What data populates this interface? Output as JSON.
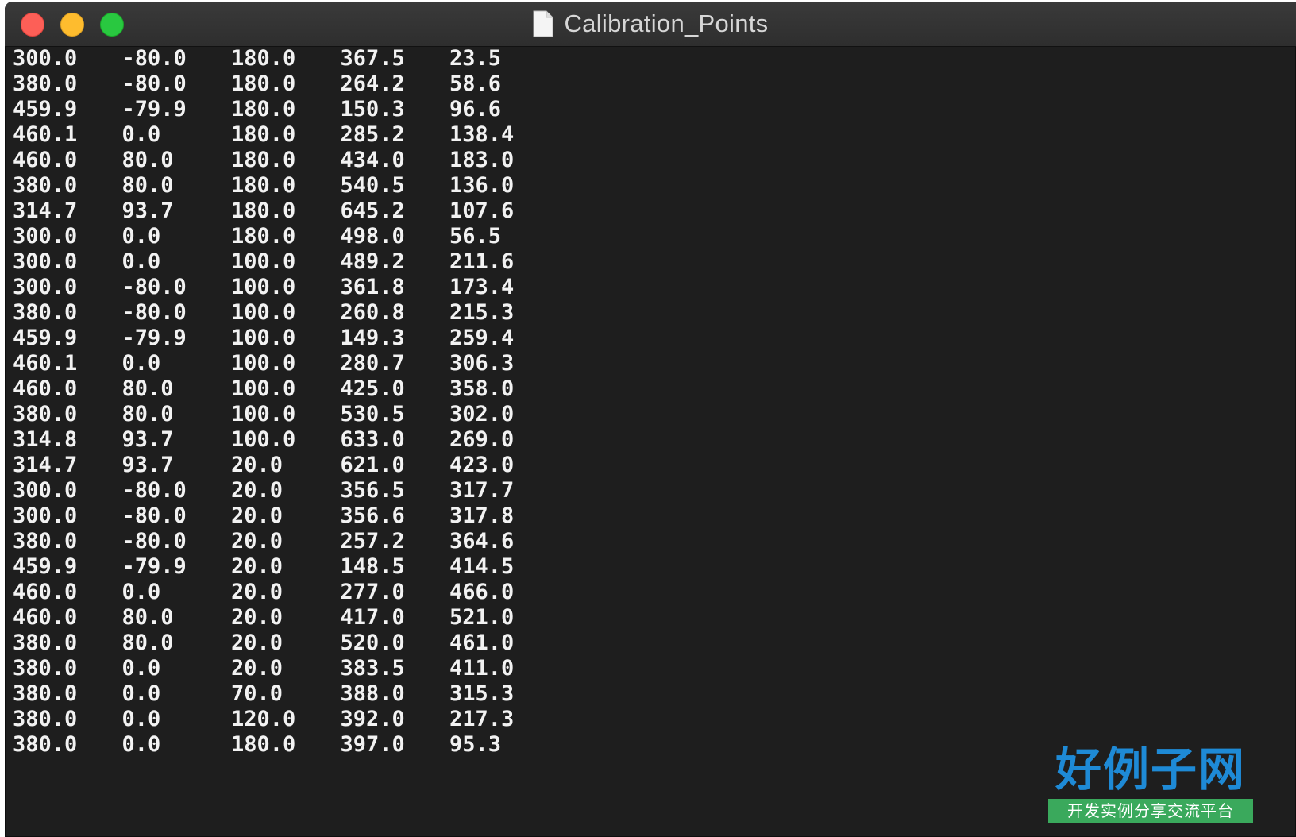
{
  "window": {
    "title": "Calibration_Points"
  },
  "rows": [
    [
      "300.0",
      "-80.0",
      "180.0",
      "367.5",
      "23.5"
    ],
    [
      "380.0",
      "-80.0",
      "180.0",
      "264.2",
      "58.6"
    ],
    [
      "459.9",
      "-79.9",
      "180.0",
      "150.3",
      "96.6"
    ],
    [
      "460.1",
      "0.0",
      "180.0",
      "285.2",
      "138.4"
    ],
    [
      "460.0",
      "80.0",
      "180.0",
      "434.0",
      "183.0"
    ],
    [
      "380.0",
      "80.0",
      "180.0",
      "540.5",
      "136.0"
    ],
    [
      "314.7",
      "93.7",
      "180.0",
      "645.2",
      "107.6"
    ],
    [
      "300.0",
      "0.0",
      "180.0",
      "498.0",
      "56.5"
    ],
    [
      "300.0",
      "0.0",
      "100.0",
      "489.2",
      "211.6"
    ],
    [
      "300.0",
      "-80.0",
      "100.0",
      "361.8",
      "173.4"
    ],
    [
      "380.0",
      "-80.0",
      "100.0",
      "260.8",
      "215.3"
    ],
    [
      "459.9",
      "-79.9",
      "100.0",
      "149.3",
      "259.4"
    ],
    [
      "460.1",
      "0.0",
      "100.0",
      "280.7",
      "306.3"
    ],
    [
      "460.0",
      "80.0",
      "100.0",
      "425.0",
      "358.0"
    ],
    [
      "380.0",
      "80.0",
      "100.0",
      "530.5",
      "302.0"
    ],
    [
      "314.8",
      "93.7",
      "100.0",
      "633.0",
      "269.0"
    ],
    [
      "314.7",
      "93.7",
      "20.0",
      "621.0",
      "423.0"
    ],
    [
      "300.0",
      "-80.0",
      "20.0",
      "356.5",
      "317.7"
    ],
    [
      "300.0",
      "-80.0",
      "20.0",
      "356.6",
      "317.8"
    ],
    [
      "380.0",
      "-80.0",
      "20.0",
      "257.2",
      "364.6"
    ],
    [
      "459.9",
      "-79.9",
      "20.0",
      "148.5",
      "414.5"
    ],
    [
      "460.0",
      "0.0",
      "20.0",
      "277.0",
      "466.0"
    ],
    [
      "460.0",
      "80.0",
      "20.0",
      "417.0",
      "521.0"
    ],
    [
      "380.0",
      "80.0",
      "20.0",
      "520.0",
      "461.0"
    ],
    [
      "380.0",
      "0.0",
      "20.0",
      "383.5",
      "411.0"
    ],
    [
      "380.0",
      "0.0",
      "70.0",
      "388.0",
      "315.3"
    ],
    [
      "380.0",
      "0.0",
      "120.0",
      "392.0",
      "217.3"
    ],
    [
      "380.0",
      "0.0",
      "180.0",
      "397.0",
      "95.3"
    ]
  ],
  "watermark": {
    "logo_text": "好例子网",
    "tagline": "开发实例分享交流平台"
  },
  "icons": {
    "close": "close-button-icon",
    "minimize": "minimize-button-icon",
    "maximize": "maximize-button-icon",
    "document": "document-icon"
  },
  "colors": {
    "background": "#1e1e1e",
    "text": "#f2f2f2",
    "close": "#fd5f57",
    "minimize": "#febc2e",
    "maximize": "#29c840",
    "watermark_blue": "#1e8ad6",
    "watermark_green": "#3aa95c"
  }
}
